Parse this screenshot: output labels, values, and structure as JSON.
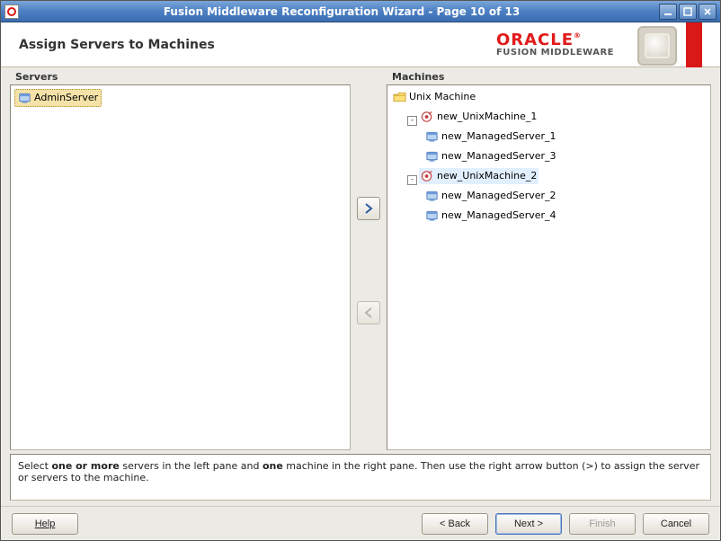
{
  "window": {
    "title": "Fusion Middleware Reconfiguration Wizard - Page 10 of 13"
  },
  "header": {
    "heading": "Assign Servers to Machines",
    "brand_oracle": "ORACLE",
    "brand_tm": "®",
    "brand_line2": "FUSION MIDDLEWARE"
  },
  "panels": {
    "servers_label": "Servers",
    "machines_label": "Machines",
    "servers": [
      {
        "name": "AdminServer",
        "selected": true
      }
    ],
    "machines_root": "Unix Machine",
    "machines": [
      {
        "name": "new_UnixMachine_1",
        "expanded": true,
        "children": [
          {
            "name": "new_ManagedServer_1"
          },
          {
            "name": "new_ManagedServer_3"
          }
        ]
      },
      {
        "name": "new_UnixMachine_2",
        "expanded": true,
        "highlight": true,
        "children": [
          {
            "name": "new_ManagedServer_2"
          },
          {
            "name": "new_ManagedServer_4"
          }
        ]
      }
    ]
  },
  "hint": {
    "pre": "Select ",
    "b1": "one or more",
    "mid1": " servers in the left pane and ",
    "b2": "one",
    "post": " machine in the right pane. Then use the right arrow button (>) to assign the server or servers to the machine."
  },
  "footer": {
    "help": "Help",
    "back": "< Back",
    "next": "Next >",
    "finish": "Finish",
    "cancel": "Cancel"
  }
}
